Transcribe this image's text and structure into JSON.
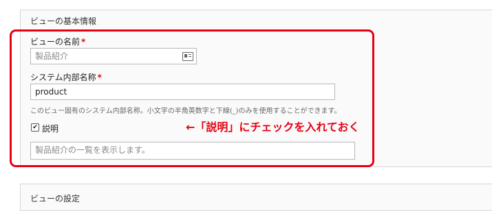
{
  "section": {
    "title": "ビューの基本情報",
    "next_section_title": "ビューの設定"
  },
  "fields": {
    "view_name": {
      "label": "ビューの名前",
      "required_mark": "*",
      "placeholder": "製品紹介"
    },
    "machine_name": {
      "label": "システム内部名称",
      "required_mark": "*",
      "value": "product",
      "help": "このビュー固有のシステム内部名称。小文字の半角英数字と下線(_)のみを使用することができます。"
    },
    "description": {
      "checkbox_label": "説明",
      "checked": true,
      "check_glyph": "✔",
      "placeholder": "製品紹介の一覧を表示します。"
    }
  },
  "annotation": {
    "text": "←「説明」にチェックを入れておく",
    "color": "#e60012"
  },
  "icons": {
    "view_name_input_icon": "contact-card-icon"
  }
}
